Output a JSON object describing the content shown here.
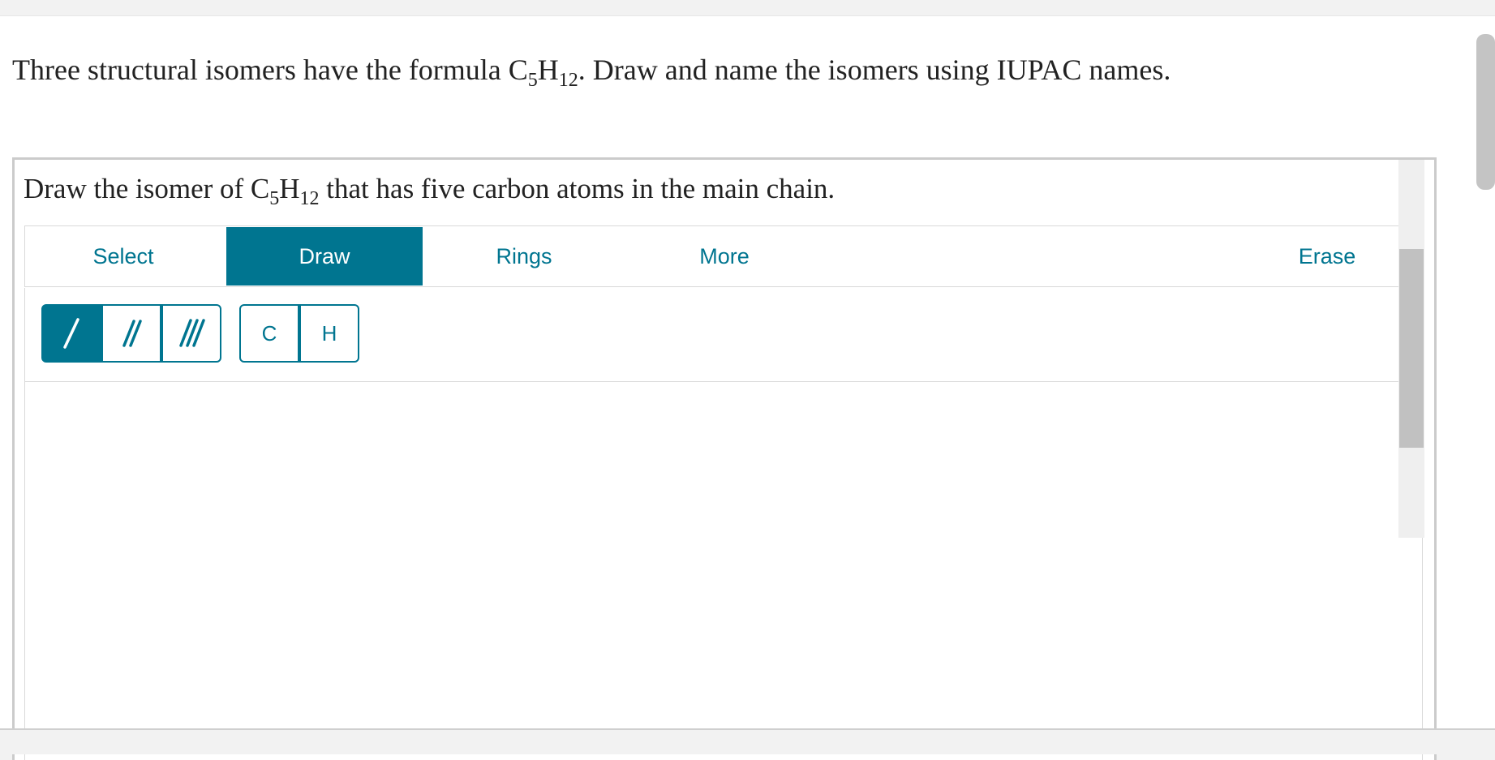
{
  "question": {
    "lead": "Three structural isomers have the formula C",
    "sub1": "5",
    "mid": "H",
    "sub2": "12",
    "tail": ". Draw and name the isomers using IUPAC names."
  },
  "prompt": {
    "lead": "Draw the isomer of C",
    "sub1": "5",
    "mid": "H",
    "sub2": "12",
    "tail": " that has five carbon atoms in the main chain."
  },
  "toolbar": {
    "tabs": [
      {
        "label": "Select",
        "active": false
      },
      {
        "label": "Draw",
        "active": true
      },
      {
        "label": "Rings",
        "active": false
      },
      {
        "label": "More",
        "active": false
      }
    ],
    "erase_label": "Erase"
  },
  "tools": {
    "single_bond_icon": "single-bond-icon",
    "double_bond_icon": "double-bond-icon",
    "triple_bond_icon": "triple-bond-icon",
    "atoms": [
      {
        "label": "C"
      },
      {
        "label": "H"
      }
    ]
  },
  "colors": {
    "accent": "#007590",
    "text": "#222222",
    "border": "#cbcbcb"
  }
}
